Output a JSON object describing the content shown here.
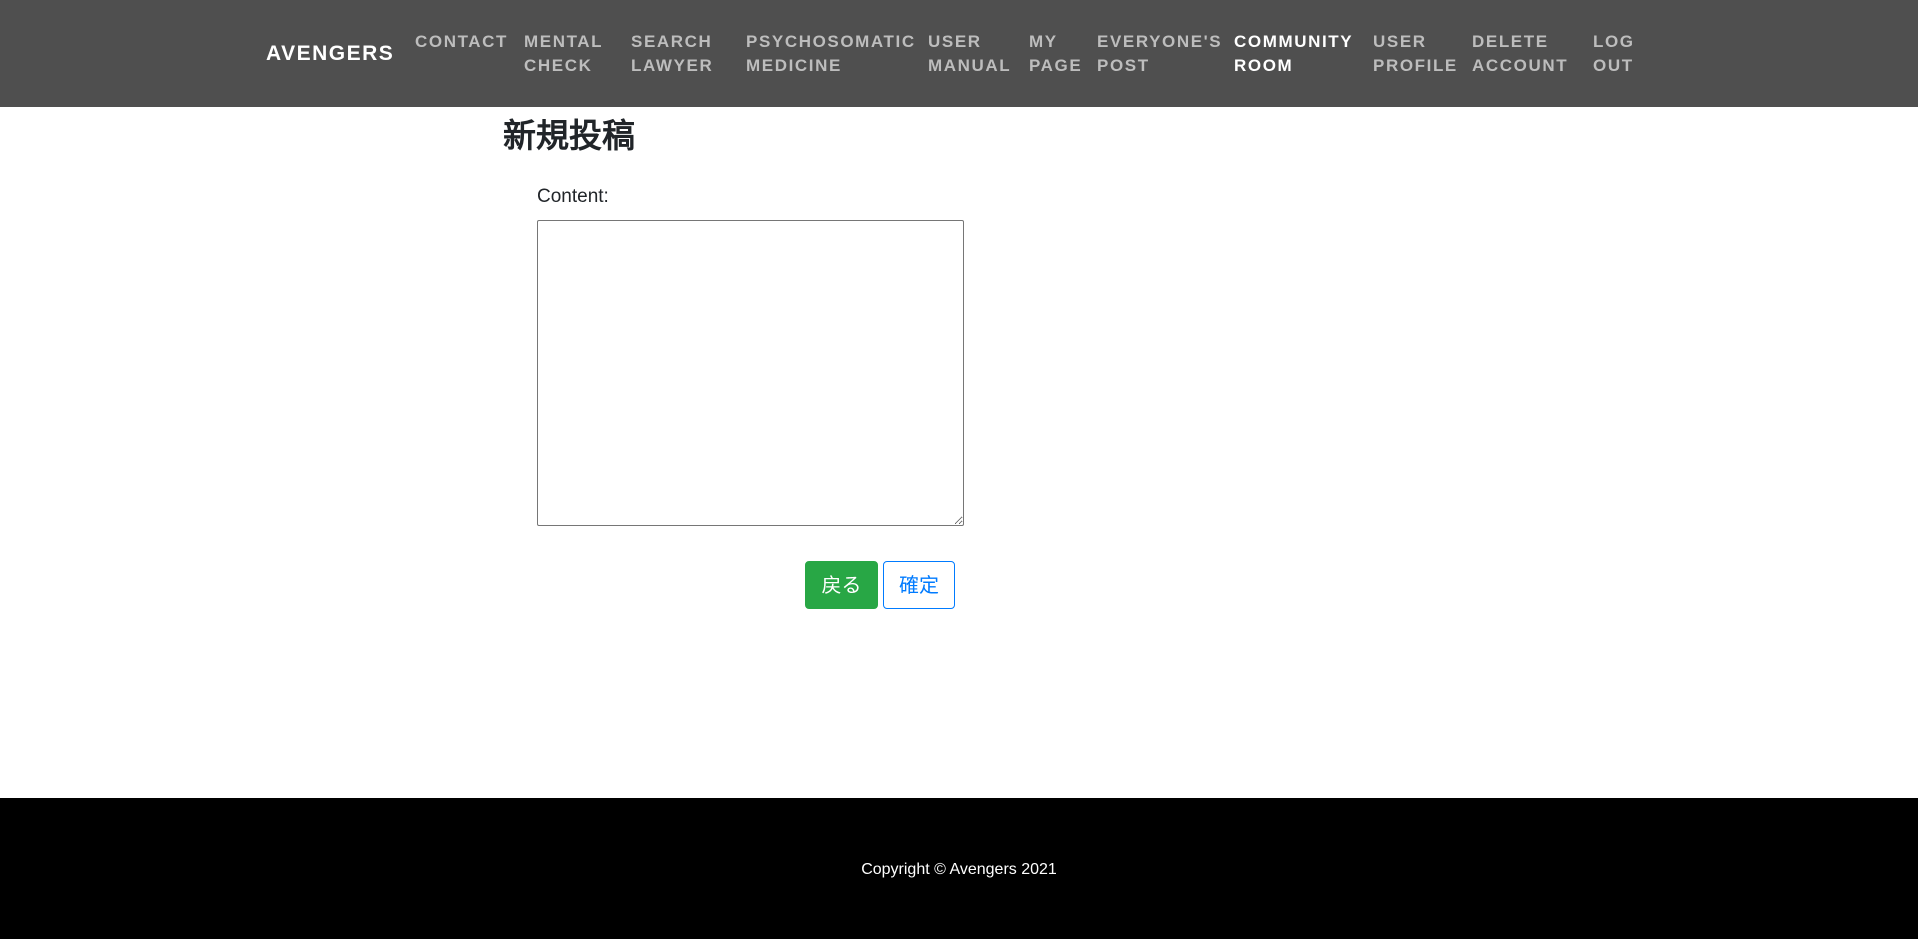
{
  "navbar": {
    "brand": "AVENGERS",
    "items": [
      {
        "line1": "CONTACT",
        "line2": ""
      },
      {
        "line1": "MENTAL",
        "line2": "CHECK"
      },
      {
        "line1": "SEARCH",
        "line2": "LAWYER"
      },
      {
        "line1": "PSYCHOSOMATIC",
        "line2": "MEDICINE"
      },
      {
        "line1": "USER",
        "line2": "MANUAL"
      },
      {
        "line1": "MY",
        "line2": "PAGE"
      },
      {
        "line1": "EVERYONE'S",
        "line2": "POST"
      },
      {
        "line1": "COMMUNITY",
        "line2": "ROOM"
      },
      {
        "line1": "USER",
        "line2": "PROFILE"
      },
      {
        "line1": "DELETE",
        "line2": "ACCOUNT"
      },
      {
        "line1": "LOG",
        "line2": "OUT"
      }
    ],
    "active_item": "COMMUNITY ROOM",
    "background_color": "#4f4f4f"
  },
  "main": {
    "title": "新規投稿",
    "content_label": "Content:",
    "content_value": "",
    "buttons": {
      "back_label": "戻る",
      "confirm_label": "確定"
    }
  },
  "footer": {
    "copyright": "Copyright © Avengers 2021"
  },
  "colors": {
    "back_button": "#28a745",
    "confirm_button_border": "#007bff",
    "footer_background": "#000000"
  }
}
